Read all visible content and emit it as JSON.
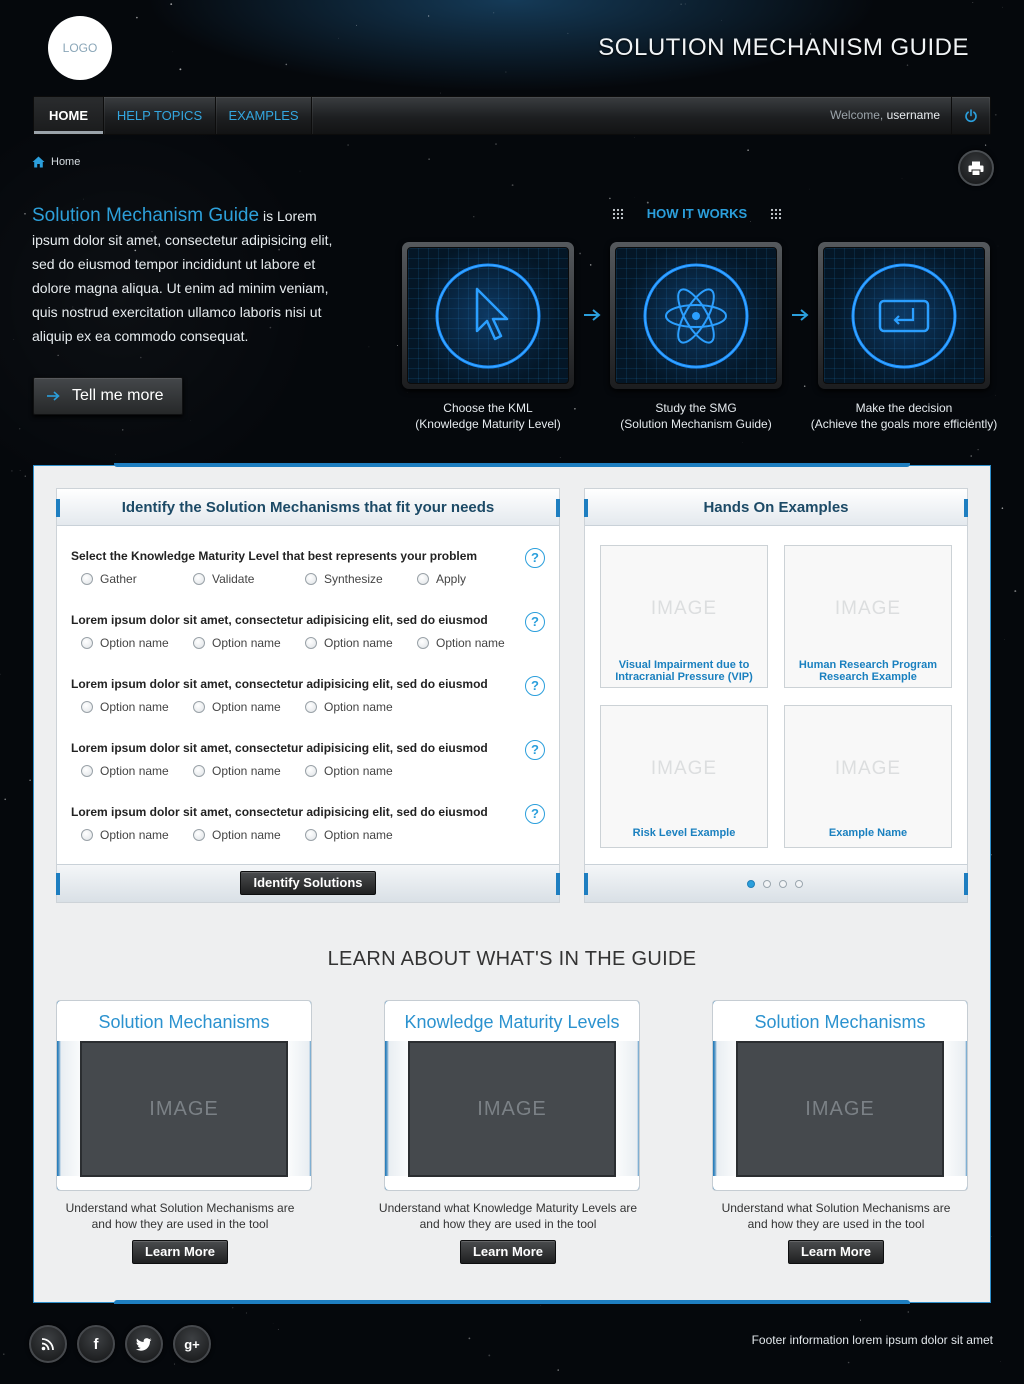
{
  "header": {
    "logo": "LOGO",
    "site_title": "SOLUTION MECHANISM GUIDE"
  },
  "nav": {
    "items": [
      {
        "label": "HOME",
        "active": true
      },
      {
        "label": "HELP TOPICS",
        "active": false
      },
      {
        "label": "EXAMPLES",
        "active": false
      }
    ],
    "welcome_prefix": "Welcome,",
    "username": "username",
    "power_icon": "power-icon"
  },
  "breadcrumb": {
    "home_label": "Home",
    "home_icon": "home-icon"
  },
  "intro": {
    "highlight": "Solution Mechanism Guide",
    "text": "is Lorem ipsum dolor sit amet, consectetur adipisicing elit, sed do eiusmod tempor incididunt ut labore et dolore magna aliqua. Ut enim ad minim veniam, quis nostrud exercitation ullamco laboris nisi ut aliquip ex ea commodo consequat.",
    "button_label": "Tell me more"
  },
  "how_it_works": {
    "title": "HOW IT WORKS",
    "steps": [
      {
        "icon": "cursor-icon",
        "line1": "Choose the KML",
        "line2": "(Knowledge Maturity  Level)"
      },
      {
        "icon": "atom-icon",
        "line1": "Study the SMG",
        "line2": "(Solution Mechanism Guide)"
      },
      {
        "icon": "enter-key-icon",
        "line1": "Make the decision",
        "line2": "(Achieve the goals more efficiently)"
      }
    ]
  },
  "identify": {
    "title": "Identify the Solution Mechanisms that fit your needs",
    "questions": [
      {
        "text": "Select the Knowledge Maturity Level that best represents your problem",
        "options": [
          "Gather",
          "Validate",
          "Synthesize",
          "Apply"
        ]
      },
      {
        "text": "Lorem ipsum dolor sit amet, consectetur adipisicing elit, sed do eiusmod",
        "options": [
          "Option name",
          "Option name",
          "Option name",
          "Option name"
        ]
      },
      {
        "text": "Lorem ipsum dolor sit amet, consectetur adipisicing elit, sed do eiusmod",
        "options": [
          "Option name",
          "Option name",
          "Option name"
        ]
      },
      {
        "text": "Lorem ipsum dolor sit amet, consectetur adipisicing elit, sed do eiusmod",
        "options": [
          "Option name",
          "Option name",
          "Option name"
        ]
      },
      {
        "text": "Lorem ipsum dolor sit amet, consectetur adipisicing elit, sed do eiusmod",
        "options": [
          "Option name",
          "Option name",
          "Option name"
        ]
      }
    ],
    "help_glyph": "?",
    "button_label": "Identify Solutions"
  },
  "examples": {
    "title": "Hands On Examples",
    "tiles": [
      {
        "image": "IMAGE",
        "caption_l1": "Visual Impairment due to",
        "caption_l2": "Intracranial Pressure (VIP)"
      },
      {
        "image": "IMAGE",
        "caption_l1": "Human Research Program",
        "caption_l2": "Research Example"
      },
      {
        "image": "IMAGE",
        "caption_l1": "Risk Level Example",
        "caption_l2": ""
      },
      {
        "image": "IMAGE",
        "caption_l1": "Example Name",
        "caption_l2": ""
      }
    ],
    "pages": 4,
    "active_page": 1
  },
  "learn": {
    "title": "LEARN ABOUT WHAT'S IN THE GUIDE",
    "cards": [
      {
        "title": "Solution Mechanisms",
        "image": "IMAGE",
        "desc_l1": "Understand what Solution Mechanisms are",
        "desc_l2": "and how they are used in the tool",
        "button": "Learn More"
      },
      {
        "title": "Knowledge Maturity Levels",
        "image": "IMAGE",
        "desc_l1": "Understand what Knowledge Maturity Levels are",
        "desc_l2": "and how they are used in the tool",
        "button": "Learn More"
      },
      {
        "title": "Solution Mechanisms",
        "image": "IMAGE",
        "desc_l1": "Understand what Solution Mechanisms are",
        "desc_l2": "and how they are used in the tool",
        "button": "Learn More"
      }
    ]
  },
  "footer": {
    "social": [
      {
        "name": "rss-icon",
        "glyph": ""
      },
      {
        "name": "facebook-icon",
        "glyph": "f"
      },
      {
        "name": "twitter-icon",
        "glyph": ""
      },
      {
        "name": "google-plus-icon",
        "glyph": "g+"
      }
    ],
    "text": "Footer information lorem ipsum dolor sit amet"
  },
  "colors": {
    "accent": "#2b9fdc",
    "panel_bg": "#eeeff0",
    "bar_blue": "#1e7ec0"
  }
}
